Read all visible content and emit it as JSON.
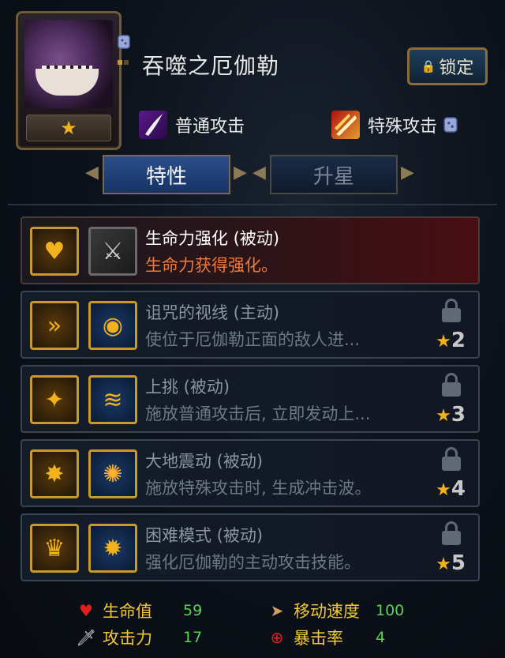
{
  "character": {
    "name": "吞噬之厄伽勒",
    "star": "★",
    "lock_label": "锁定"
  },
  "attacks": {
    "normal_label": "普通攻击",
    "special_label": "特殊攻击"
  },
  "tabs": [
    {
      "label": "特性",
      "active": true
    },
    {
      "label": "升星",
      "active": false
    }
  ],
  "skills": [
    {
      "title": "生命力强化 (被动)",
      "desc": "生命力获得强化。",
      "locked": false,
      "req_star": ""
    },
    {
      "title": "诅咒的视线 (主动)",
      "desc": "使位于厄伽勒正面的敌人进...",
      "locked": true,
      "req_star": "2"
    },
    {
      "title": "上挑 (被动)",
      "desc": "施放普通攻击后, 立即发动上...",
      "locked": true,
      "req_star": "3"
    },
    {
      "title": "大地震动 (被动)",
      "desc": "施放特殊攻击时, 生成冲击波。",
      "locked": true,
      "req_star": "4"
    },
    {
      "title": "困难模式 (被动)",
      "desc": "强化厄伽勒的主动攻击技能。",
      "locked": true,
      "req_star": "5"
    }
  ],
  "stats": {
    "hp_label": "生命值",
    "hp_value": "59",
    "atk_label": "攻击力",
    "atk_value": "17",
    "move_label": "移动速度",
    "move_value": "100",
    "crit_label": "暴击率",
    "crit_value": "4"
  },
  "icons": {
    "heart": "heart-icon",
    "sword": "sword-icon",
    "boot": "boot-icon",
    "crosshair": "crosshair-icon"
  },
  "colors": {
    "gold": "#f2b21d",
    "stat_value": "#5cd05a",
    "active_desc": "#f07a3a"
  }
}
